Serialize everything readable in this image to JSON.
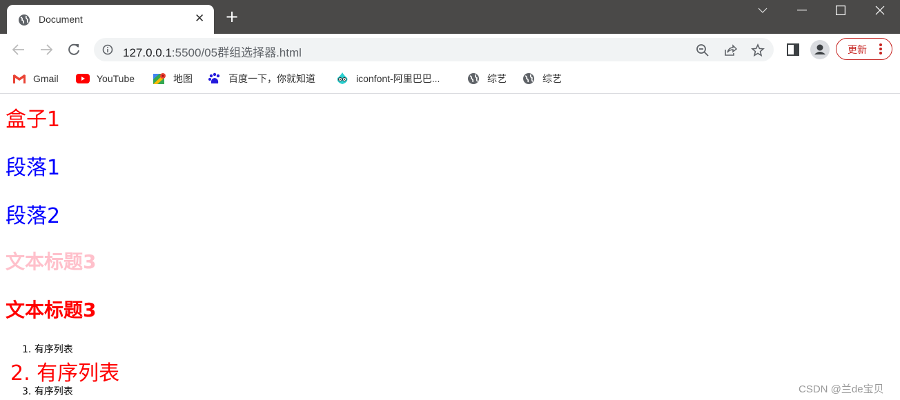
{
  "browser": {
    "tab": {
      "title": "Document",
      "close_glyph": "✕"
    },
    "new_tab_glyph": "+",
    "window_controls": {
      "tab_search": "⌄",
      "minimize": "—",
      "maximize": "☐",
      "close": "✕"
    },
    "nav": {
      "back": "←",
      "forward": "→",
      "reload": "↻"
    },
    "address": {
      "host": "127.0.0.1",
      "rest": ":5500/05群组选择器.html"
    },
    "update_button": {
      "label": "更新"
    },
    "bookmarks": [
      {
        "label": "Gmail",
        "icon": "gmail-icon"
      },
      {
        "label": "YouTube",
        "icon": "youtube-icon"
      },
      {
        "label": "地图",
        "icon": "maps-icon"
      },
      {
        "label": "百度一下，你就知道",
        "icon": "baidu-icon"
      },
      {
        "label": "iconfont-阿里巴巴...",
        "icon": "iconfont-icon"
      },
      {
        "label": "综艺",
        "icon": "globe-icon"
      },
      {
        "label": "综艺",
        "icon": "globe-icon"
      }
    ]
  },
  "page": {
    "div_box1": "盒子1",
    "paragraph1": "段落1",
    "paragraph2": "段落2",
    "heading_pink": "文本标题3",
    "heading_red": "文本标题3",
    "ordered_list": [
      {
        "marker": "1.",
        "text": "有序列表"
      },
      {
        "marker": "2.",
        "text": "有序列表"
      },
      {
        "marker": "3.",
        "text": "有序列表"
      }
    ],
    "colors": {
      "red": "#ff0000",
      "blue": "#0000ff",
      "pink": "#ffc0cb"
    }
  },
  "watermark": "CSDN @兰de宝贝"
}
